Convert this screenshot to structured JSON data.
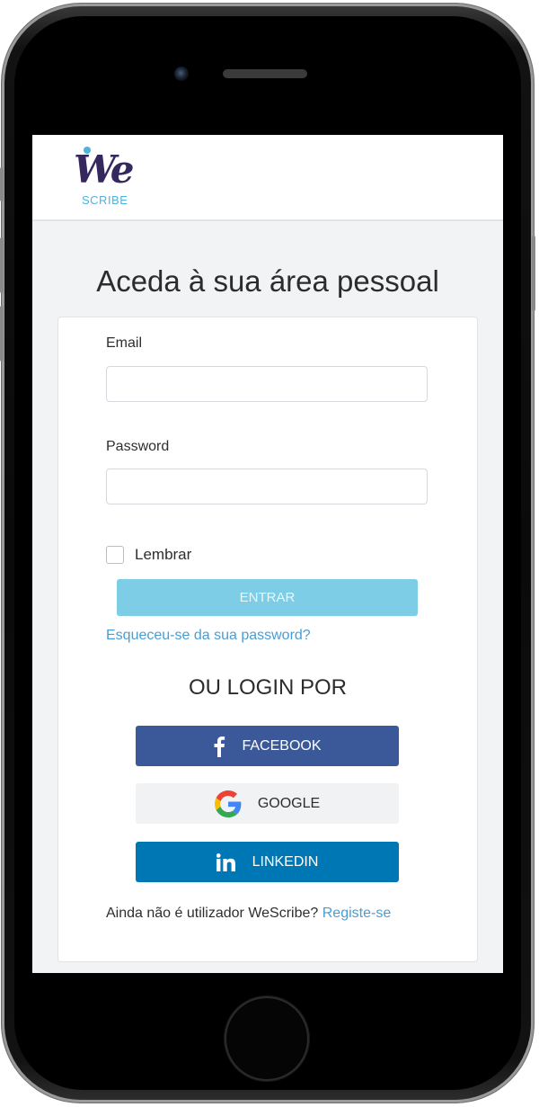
{
  "app": {
    "logo_text": "We",
    "logo_subtext": "SCRIBE"
  },
  "page": {
    "title": "Aceda à sua área pessoal"
  },
  "form": {
    "email_label": "Email",
    "email_value": "",
    "password_label": "Password",
    "password_value": "",
    "remember_label": "Lembrar",
    "remember_checked": false,
    "submit_label": "ENTRAR",
    "forgot_link": "Esqueceu-se da sua password?"
  },
  "social_login": {
    "heading": "OU LOGIN POR",
    "facebook_label": "FACEBOOK",
    "google_label": "GOOGLE",
    "linkedin_label": "LINKEDIN"
  },
  "signup": {
    "prompt": "Ainda não é utilizador WeScribe?",
    "link": "Registe-se"
  },
  "icons": {
    "facebook": "facebook-icon",
    "google": "google-icon",
    "linkedin": "linkedin-icon"
  },
  "colors": {
    "brand_dark": "#34285f",
    "brand_light": "#4fb3df",
    "submit": "#7ecde7",
    "facebook": "#3b5998",
    "linkedin": "#0077b5",
    "link": "#4a9dd2"
  }
}
